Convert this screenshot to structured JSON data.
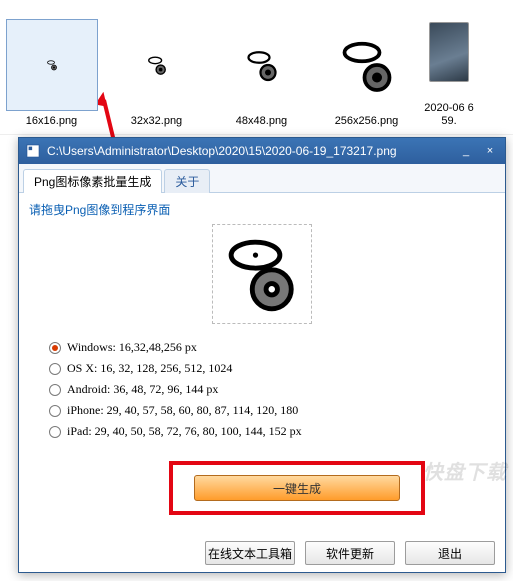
{
  "desktop": {
    "files": [
      {
        "name": "16x16.png",
        "selected": true,
        "size": 12
      },
      {
        "name": "32x32.png",
        "selected": false,
        "size": 22
      },
      {
        "name": "48x48.png",
        "selected": false,
        "size": 36
      },
      {
        "name": "256x256.png",
        "selected": false,
        "size": 60
      },
      {
        "name": "2020-06 659.",
        "selected": false,
        "photo": true
      }
    ]
  },
  "window": {
    "title": "C:\\Users\\Administrator\\Desktop\\2020\\15\\2020-06-19_173217.png",
    "tabs": {
      "main": "Png图标像素批量生成",
      "about": "关于"
    },
    "hint": "请拖曳Png图像到程序界面",
    "options": {
      "windows": "Windows: 16,32,48,256 px",
      "osx": "OS X: 16, 32, 128, 256, 512, 1024",
      "android": "Android: 36, 48, 72, 96, 144 px",
      "iphone": "iPhone: 29, 40, 57, 58, 60, 80, 87, 114, 120, 180",
      "ipad": "iPad: 29, 40, 50, 58, 72, 76, 80, 100, 144, 152 px"
    },
    "generate_label": "一键生成",
    "buttons": {
      "toolbox": "在线文本工具箱",
      "update": "软件更新",
      "exit": "退出"
    },
    "controls": {
      "minimize": "_",
      "close": "×"
    }
  }
}
